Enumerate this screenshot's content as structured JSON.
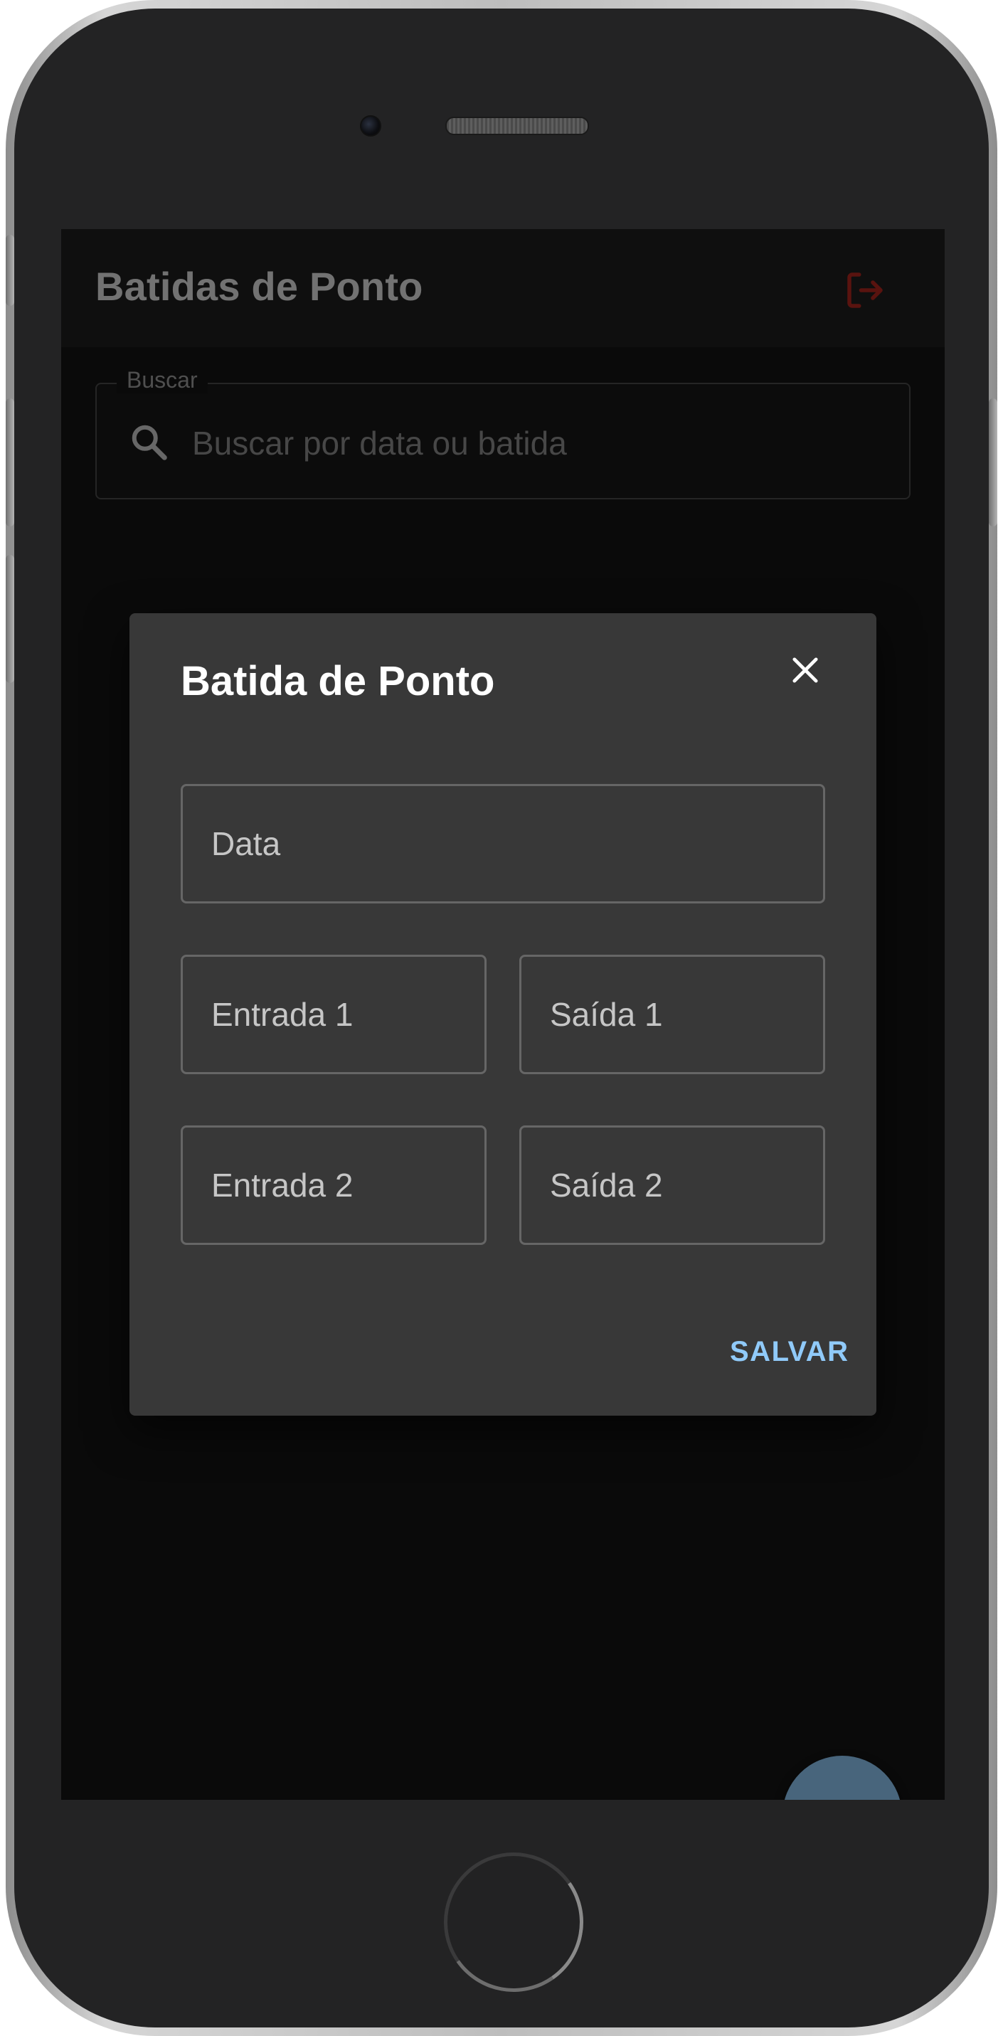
{
  "app": {
    "title": "Batidas de Ponto",
    "logout_icon": "logout-icon"
  },
  "search": {
    "legend": "Buscar",
    "placeholder": "Buscar por data ou batida",
    "value": "",
    "icon": "search-icon"
  },
  "dialog": {
    "title": "Batida de Ponto",
    "close_icon": "close-icon",
    "fields": {
      "data": {
        "placeholder": "Data",
        "value": ""
      },
      "entrada1": {
        "placeholder": "Entrada 1",
        "value": ""
      },
      "saida1": {
        "placeholder": "Saída 1",
        "value": ""
      },
      "entrada2": {
        "placeholder": "Entrada 2",
        "value": ""
      },
      "saida2": {
        "placeholder": "Saída 2",
        "value": ""
      }
    },
    "save_label": "SALVAR"
  },
  "fab": {
    "icon": "plus-icon"
  },
  "colors": {
    "accent": "#90caf9",
    "logout": "#b3261e",
    "dialog_bg": "#383838",
    "appbar_bg": "#1e1e1e",
    "screen_bg": "#141414"
  }
}
